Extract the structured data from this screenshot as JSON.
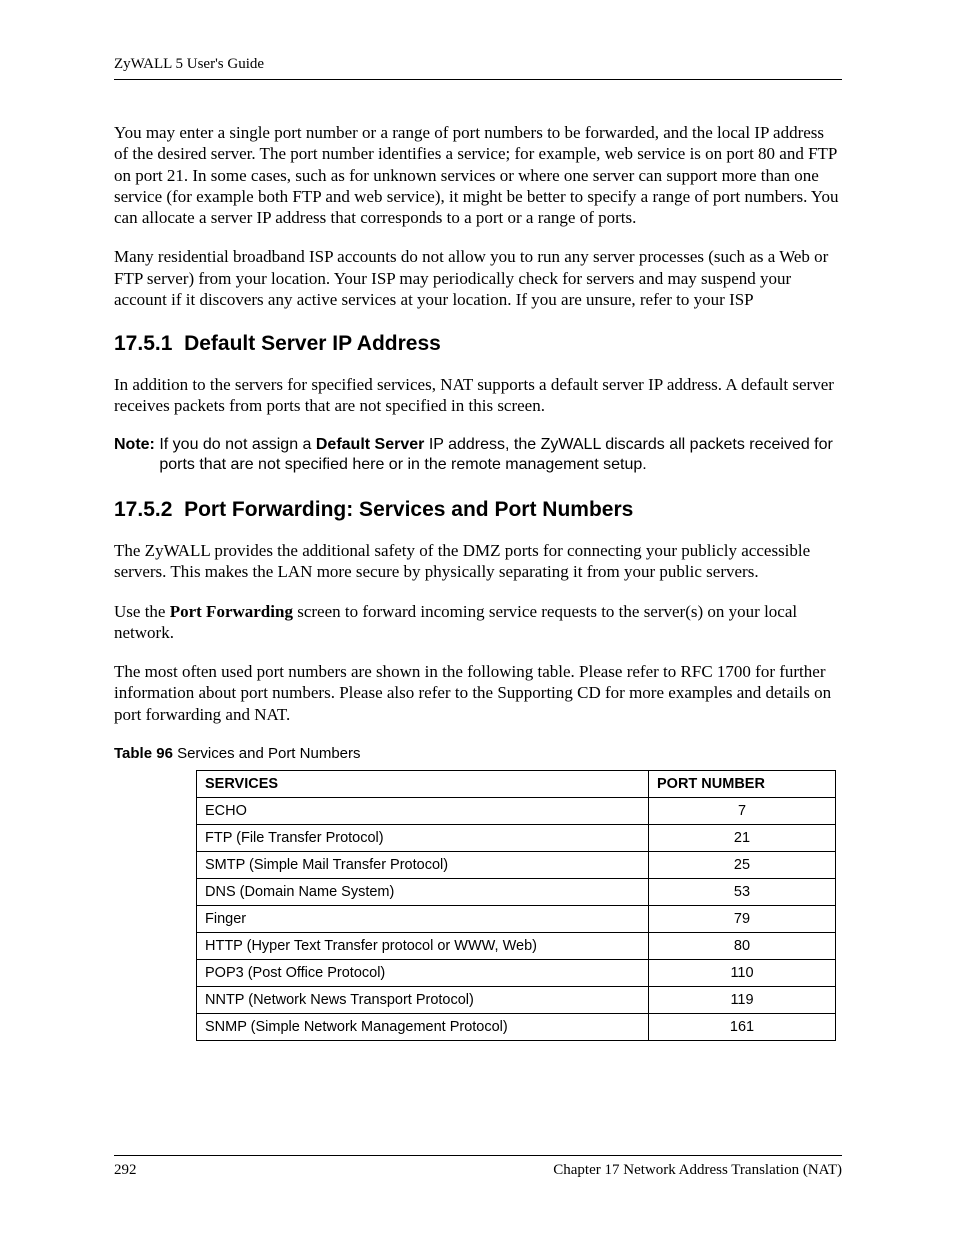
{
  "header": {
    "running_head": "ZyWALL 5 User's Guide"
  },
  "intro": {
    "para1": "You may enter a single port number or a range of port numbers to be forwarded, and the local IP address of the desired server. The port number identifies a service; for example, web service is on port 80 and FTP on port 21. In some cases, such as for unknown services or where one server can support more than one service (for example both FTP and web service), it might be better to specify a range of port numbers. You can allocate a server IP address that corresponds to a port or a range of ports.",
    "para2": "Many residential broadband ISP accounts do not allow you to run any server processes (such as a Web or FTP server) from your location. Your ISP may periodically check for servers and may suspend your account if it discovers any active services at your location. If you are unsure, refer to your ISP"
  },
  "section1": {
    "number": "17.5.1",
    "title": "Default Server IP Address",
    "para1": "In addition to the servers for specified services, NAT supports a default server IP address. A default server receives packets from ports that are not specified in this screen.",
    "note_label": "Note: ",
    "note_pre": "If you do not assign a ",
    "note_bold": "Default Server",
    "note_post": " IP address, the ZyWALL discards all packets received for ports that are not specified here or in the remote management setup."
  },
  "section2": {
    "number": "17.5.2",
    "title": "Port Forwarding: Services and Port Numbers",
    "para1": "The ZyWALL provides the additional safety of the DMZ ports for connecting your publicly accessible servers. This makes the LAN more secure by physically separating it from your public servers.",
    "para2_pre": "Use the ",
    "para2_bold": "Port Forwarding",
    "para2_post": " screen to forward incoming service requests to the server(s) on your local network.",
    "para3": "The most often used port numbers are shown in the following table. Please refer to RFC 1700 for further information about port numbers. Please also refer to the Supporting CD for more examples and details on port forwarding and NAT."
  },
  "table": {
    "caption_label": "Table 96",
    "caption_title": "   Services and Port Numbers",
    "headers": {
      "services": "SERVICES",
      "port": "PORT NUMBER"
    },
    "rows": [
      {
        "service": "ECHO",
        "port": "7"
      },
      {
        "service": "FTP (File Transfer Protocol)",
        "port": "21"
      },
      {
        "service": "SMTP (Simple Mail Transfer Protocol)",
        "port": "25"
      },
      {
        "service": "DNS (Domain Name System)",
        "port": "53"
      },
      {
        "service": "Finger",
        "port": "79"
      },
      {
        "service": "HTTP (Hyper Text Transfer protocol or WWW, Web)",
        "port": "80"
      },
      {
        "service": "POP3 (Post Office Protocol)",
        "port": "110"
      },
      {
        "service": "NNTP (Network News Transport Protocol)",
        "port": "119"
      },
      {
        "service": "SNMP (Simple Network Management Protocol)",
        "port": "161"
      }
    ]
  },
  "footer": {
    "page_number": "292",
    "chapter": "Chapter 17 Network Address Translation (NAT)"
  }
}
